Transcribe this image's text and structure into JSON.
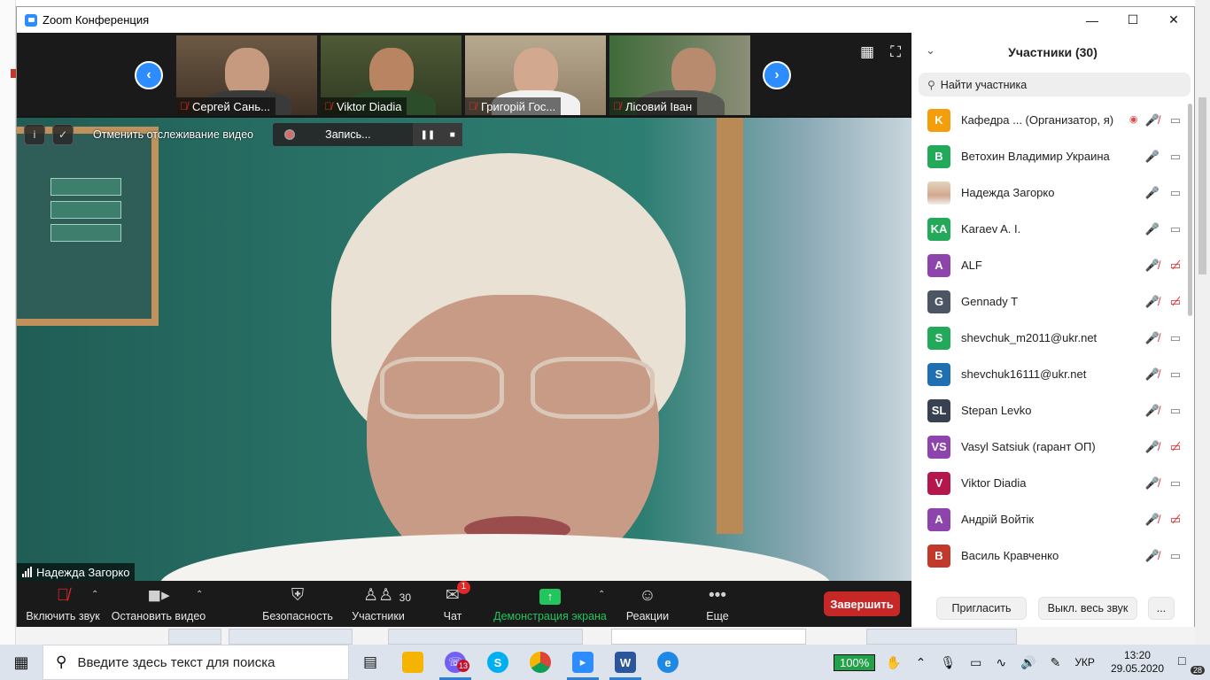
{
  "window": {
    "title": "Zoom Конференция"
  },
  "gallery": {
    "thumbs": [
      {
        "name": "Сергей Сань..."
      },
      {
        "name": "Viktor Diadia"
      },
      {
        "name": "Григорій Гос..."
      },
      {
        "name": "Лісовий Іван"
      }
    ]
  },
  "overlay": {
    "stop_tracking": "Отменить отслеживание видео",
    "recording": "Запись..."
  },
  "speaker": {
    "name": "Надежда Загорко"
  },
  "toolbar": {
    "unmute": "Включить звук",
    "stop_video": "Остановить видео",
    "security": "Безопасность",
    "participants": "Участники",
    "participants_count": "30",
    "chat": "Чат",
    "chat_badge": "1",
    "share": "Демонстрация экрана",
    "reactions": "Реакции",
    "more": "Еще",
    "end": "Завершить"
  },
  "panel": {
    "title": "Участники (30)",
    "search_placeholder": "Найти участника",
    "participants": [
      {
        "initials": "K",
        "name": "Кафедра ... (Организатор, я)",
        "color": "#f59e0b",
        "mic": "off",
        "cam": "on",
        "host": true
      },
      {
        "initials": "B",
        "name": "Ветохин Владимир Украина",
        "color": "#22a95a",
        "mic": "on",
        "cam": "on"
      },
      {
        "initials": "",
        "name": "Надежда Загорко",
        "color": "#d8b9a3",
        "mic": "active",
        "cam": "on",
        "photo": true
      },
      {
        "initials": "KA",
        "name": "Karaev A. I.",
        "color": "#22a95a",
        "mic": "on",
        "cam": "on"
      },
      {
        "initials": "A",
        "name": "ALF",
        "color": "#8e44ad",
        "mic": "off",
        "cam": "off"
      },
      {
        "initials": "G",
        "name": "Gennady T",
        "color": "#4b5563",
        "mic": "off",
        "cam": "off"
      },
      {
        "initials": "S",
        "name": "shevchuk_m2011@ukr.net",
        "color": "#22a95a",
        "mic": "off",
        "cam": "on"
      },
      {
        "initials": "S",
        "name": "shevchuk16111@ukr.net",
        "color": "#1f6fb2",
        "mic": "off",
        "cam": "on"
      },
      {
        "initials": "SL",
        "name": "Stepan Levko",
        "color": "#374151",
        "mic": "off",
        "cam": "on"
      },
      {
        "initials": "VS",
        "name": "Vasyl Satsiuk (гарант ОП)",
        "color": "#8e44ad",
        "mic": "off",
        "cam": "off"
      },
      {
        "initials": "V",
        "name": "Viktor Diadia",
        "color": "#b5174d",
        "mic": "off",
        "cam": "on"
      },
      {
        "initials": "A",
        "name": "Андрій Войтік",
        "color": "#8e44ad",
        "mic": "off",
        "cam": "off"
      },
      {
        "initials": "B",
        "name": "Василь Кравченко",
        "color": "#c0392b",
        "mic": "off",
        "cam": "on"
      }
    ],
    "invite": "Пригласить",
    "mute_all": "Выкл. весь звук",
    "more": "..."
  },
  "taskbar": {
    "search_placeholder": "Введите здесь текст для поиска",
    "viber_badge": "13",
    "zoom_level": "100%",
    "lang": "УКР",
    "time": "13:20",
    "date": "29.05.2020",
    "notifications": "28"
  },
  "colors": {
    "zoom_blue": "#2d8cff",
    "end_red": "#c62828",
    "share_green": "#22c55e"
  }
}
